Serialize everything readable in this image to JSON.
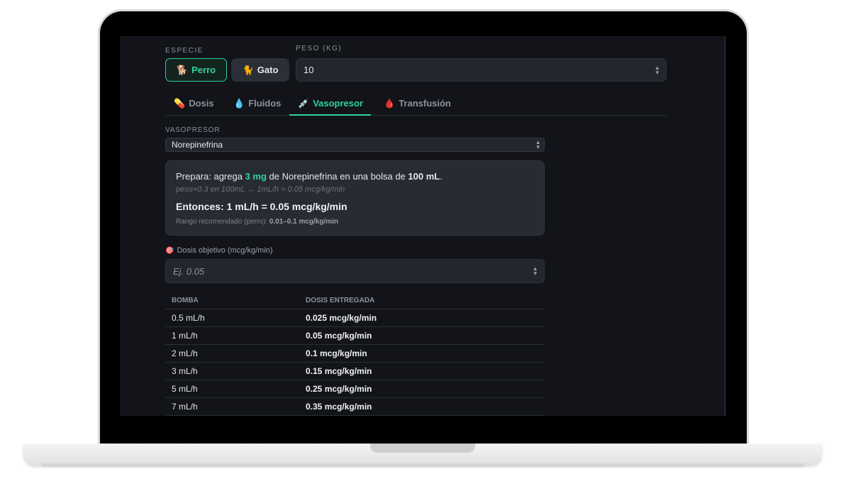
{
  "species": {
    "label": "ESPECIE",
    "options": [
      {
        "label": "Perro",
        "icon": "🐕",
        "active": true
      },
      {
        "label": "Gato",
        "icon": "🐈",
        "active": false
      }
    ]
  },
  "weight": {
    "label": "PESO (KG)",
    "value": "10"
  },
  "tabs": [
    {
      "label": "Dosis",
      "icon": "💊",
      "active": false
    },
    {
      "label": "Fluidos",
      "icon": "💧",
      "active": false
    },
    {
      "label": "Vasopresor",
      "icon": "💉",
      "active": true
    },
    {
      "label": "Transfusión",
      "icon": "🩸",
      "active": false
    }
  ],
  "vasopressor": {
    "label": "VASOPRESOR",
    "selected": "Norepinefrina"
  },
  "card": {
    "prep_prefix": "Prepara: agrega ",
    "prep_amount": "3 mg",
    "prep_mid": " de Norepinefrina en una bolsa de ",
    "prep_volume": "100 mL",
    "prep_suffix": ".",
    "formula": "peso×0.3 en 100mL → 1mL/h = 0.05 mcg/kg/min",
    "then": "Entonces: 1 mL/h = 0.05 mcg/kg/min",
    "range_prefix": "Rango recomendado (perro): ",
    "range_value": "0.01–0.1 mcg/kg/min"
  },
  "target": {
    "icon": "🎯",
    "label": "Dosis objetivo (mcg/kg/min)",
    "placeholder": "Ej. 0.05"
  },
  "table": {
    "headers": [
      "BOMBA",
      "DOSIS ENTREGADA"
    ],
    "rows": [
      {
        "rate": "0.5 mL/h",
        "dose": "0.025 mcg/kg/min"
      },
      {
        "rate": "1 mL/h",
        "dose": "0.05 mcg/kg/min"
      },
      {
        "rate": "2 mL/h",
        "dose": "0.1 mcg/kg/min"
      },
      {
        "rate": "3 mL/h",
        "dose": "0.15 mcg/kg/min"
      },
      {
        "rate": "5 mL/h",
        "dose": "0.25 mcg/kg/min"
      },
      {
        "rate": "7 mL/h",
        "dose": "0.35 mcg/kg/min"
      }
    ]
  },
  "colors": {
    "accent": "#2ed3a0",
    "background": "#121419",
    "card": "#272b32"
  }
}
